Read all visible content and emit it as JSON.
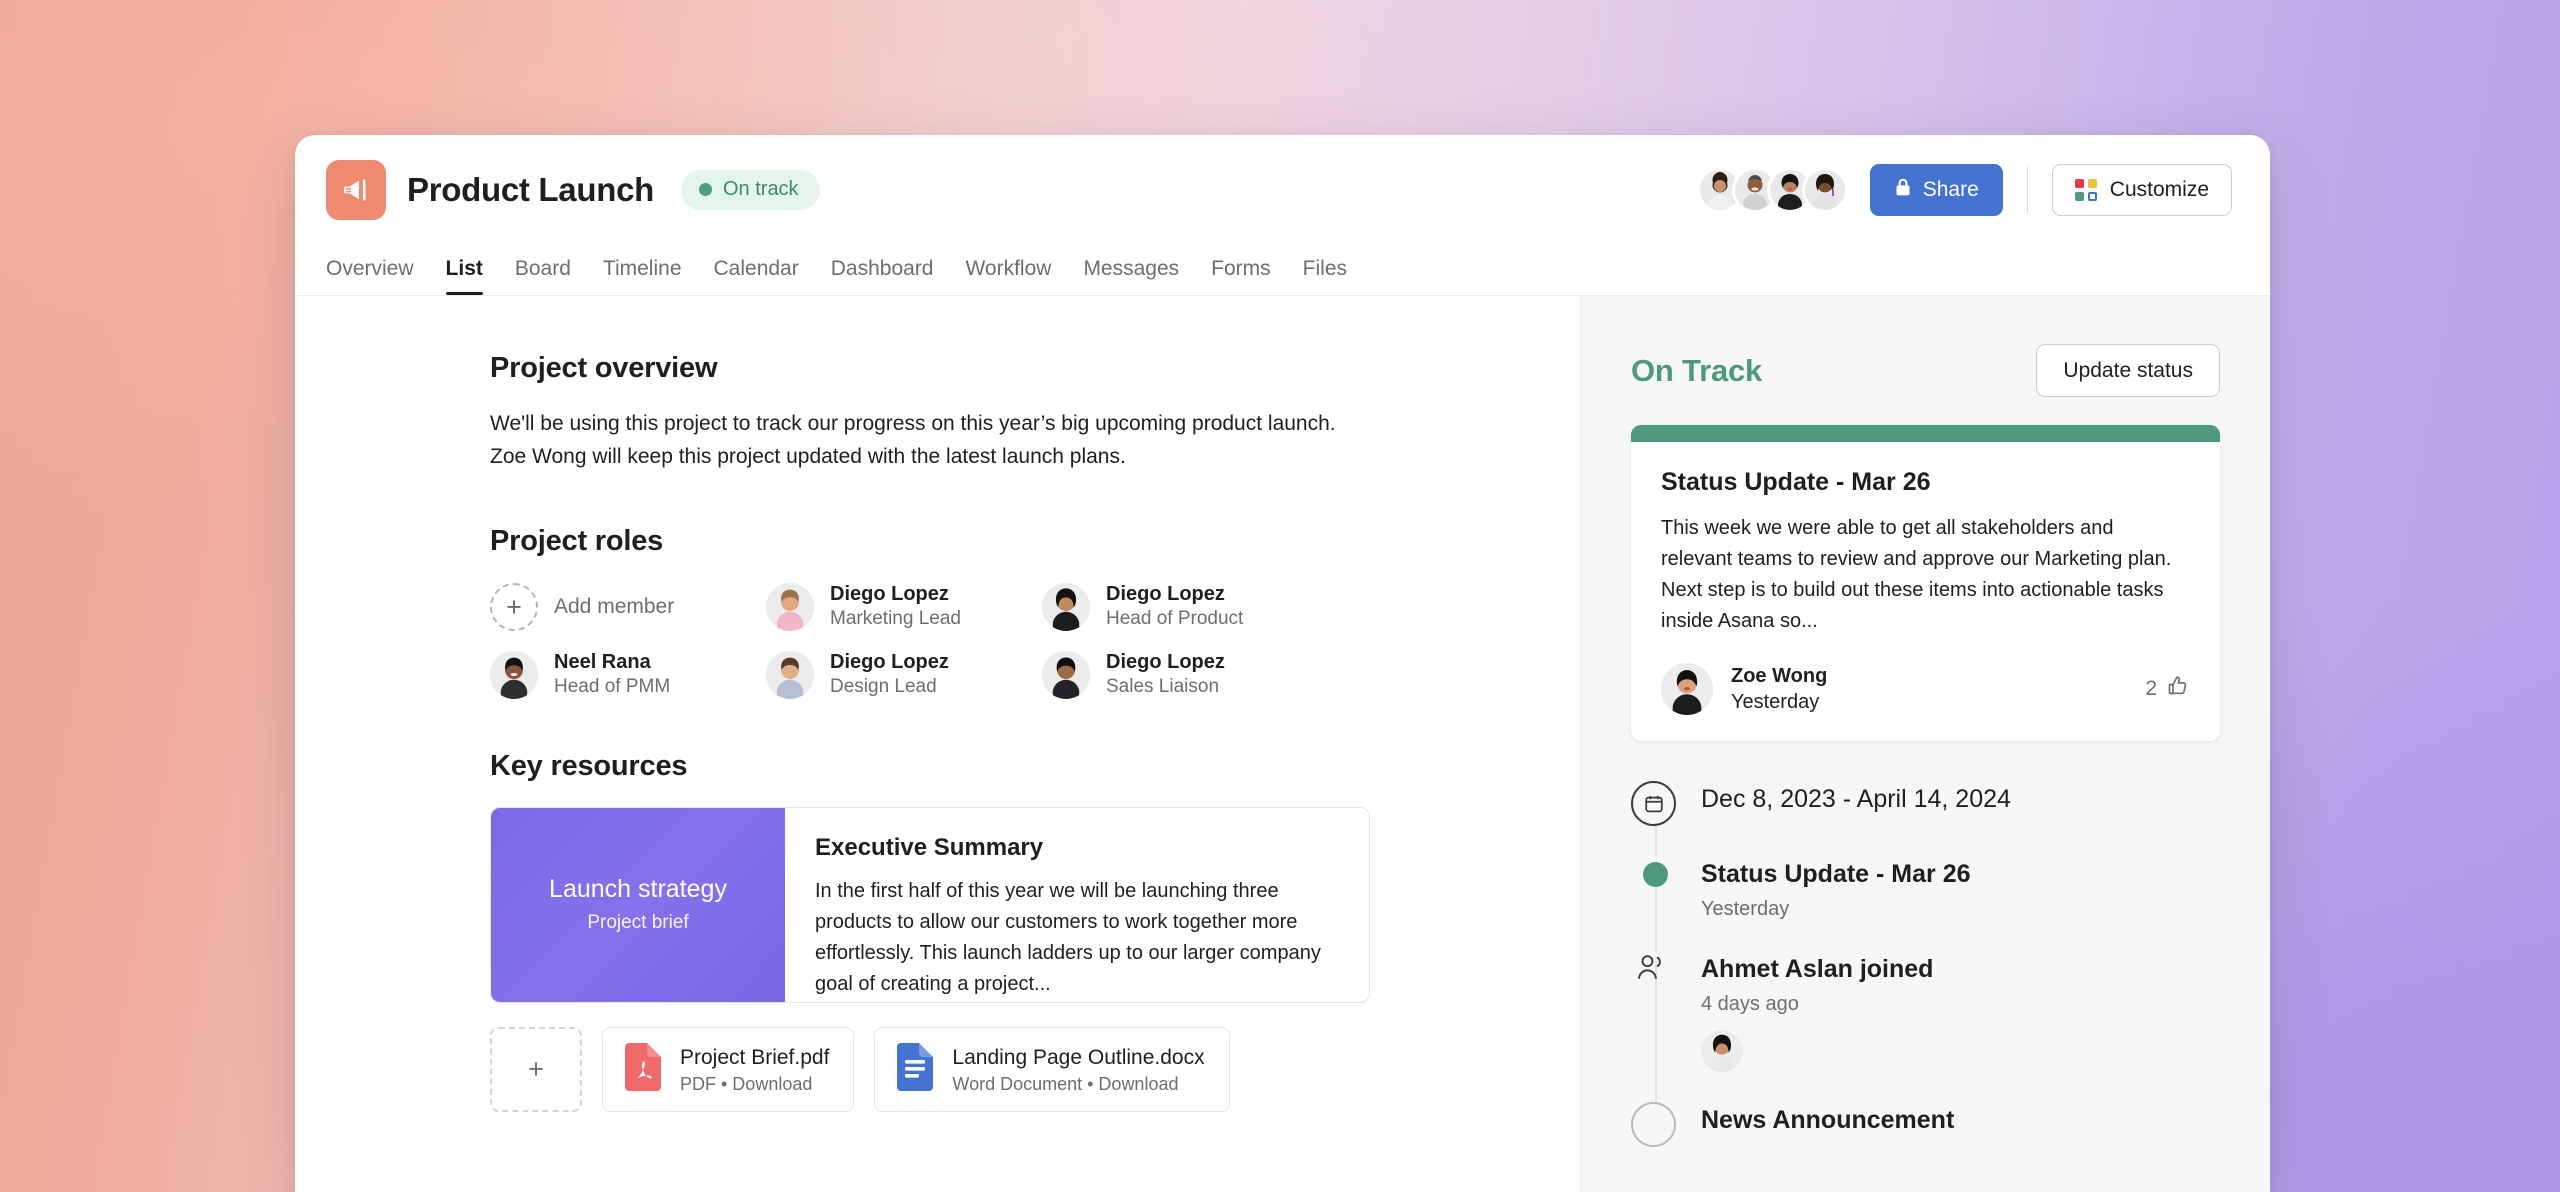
{
  "background": {
    "gradient_start": "#eea795",
    "gradient_mid": "#f0d3d6",
    "gradient_end": "#b3a0e7"
  },
  "header": {
    "project_icon": "megaphone-icon",
    "project_icon_bg": "#ef8a72",
    "title": "Product Launch",
    "status": {
      "label": "On track",
      "dot_color": "#4f9e7f",
      "pill_bg": "#e4f5ec",
      "text_color": "#3f8a6d"
    },
    "members_count": 4,
    "share_label": "Share",
    "share_icon": "lock-icon",
    "share_color": "#4573d2",
    "customize_label": "Customize",
    "customize_icon": "color-grid-icon",
    "customize_swatches": [
      "#e8384f",
      "#e8c43c",
      "#4c9a79",
      "#4573d2"
    ]
  },
  "tabs": [
    {
      "label": "Overview",
      "active": false
    },
    {
      "label": "List",
      "active": true
    },
    {
      "label": "Board",
      "active": false
    },
    {
      "label": "Timeline",
      "active": false
    },
    {
      "label": "Calendar",
      "active": false
    },
    {
      "label": "Dashboard",
      "active": false
    },
    {
      "label": "Workflow",
      "active": false
    },
    {
      "label": "Messages",
      "active": false
    },
    {
      "label": "Forms",
      "active": false
    },
    {
      "label": "Files",
      "active": false
    }
  ],
  "main": {
    "overview": {
      "heading": "Project overview",
      "line1": "We'll be using this project to track our progress on this year’s big upcoming product launch.",
      "line2": "Zoe Wong will keep this project updated with the latest launch plans."
    },
    "roles": {
      "heading": "Project roles",
      "add_member_label": "Add member",
      "add_member_icon": "plus-icon",
      "members": [
        {
          "name": "Diego Lopez",
          "title": "Marketing Lead"
        },
        {
          "name": "Diego Lopez",
          "title": "Head of Product"
        },
        {
          "name": "Neel Rana",
          "title": "Head of PMM"
        },
        {
          "name": "Diego Lopez",
          "title": "Design Lead"
        },
        {
          "name": "Diego Lopez",
          "title": "Sales Liaison"
        }
      ]
    },
    "key_resources": {
      "heading": "Key resources",
      "brief_card": {
        "thumb_title": "Launch strategy",
        "thumb_subtitle": "Project brief",
        "thumb_color": "#7b6ae8",
        "title": "Executive Summary",
        "description": "In the first half of this year we will be launching three products to allow our customers to work together more effortlessly. This launch ladders up to our larger company goal of creating a project..."
      },
      "add_attachment_icon": "plus-icon",
      "attachments": [
        {
          "name": "Project Brief.pdf",
          "meta": "PDF • Download",
          "icon": "pdf-file-icon",
          "icon_color": "#f06a6a"
        },
        {
          "name": "Landing Page Outline.docx",
          "meta": "Word Document • Download",
          "icon": "word-file-icon",
          "icon_color": "#4573d2"
        }
      ]
    }
  },
  "right_rail": {
    "title": "On Track",
    "title_color": "#4c9a79",
    "update_status_label": "Update status",
    "status_card": {
      "accent_color": "#4c9a79",
      "title": "Status Update - Mar 26",
      "body": "This week we were able to get all stakeholders and relevant teams to review and approve our Marketing plan. Next step is to build out these items into actionable tasks inside Asana so...",
      "author": "Zoe Wong",
      "timestamp": "Yesterday",
      "like_count": "2",
      "like_icon": "thumbs-up-icon"
    },
    "timeline": [
      {
        "marker": "calendar-icon",
        "title": "Dec 8, 2023 - April 14, 2024",
        "bold": false,
        "sub": "",
        "has_avatar": false
      },
      {
        "marker": "green-dot",
        "title": "Status Update - Mar 26",
        "bold": true,
        "sub": "Yesterday",
        "has_avatar": false
      },
      {
        "marker": "people-icon",
        "title": "Ahmet Aslan joined",
        "bold": true,
        "sub": "4 days ago",
        "has_avatar": true
      },
      {
        "marker": "empty-circle",
        "title": "News Announcement",
        "bold": true,
        "sub": "",
        "has_avatar": false
      }
    ]
  }
}
